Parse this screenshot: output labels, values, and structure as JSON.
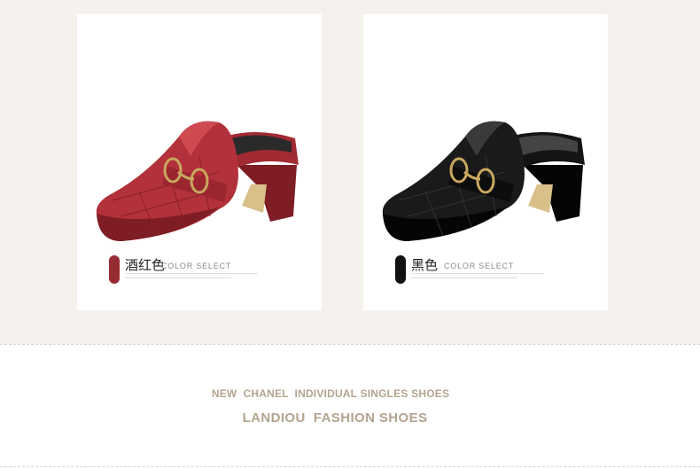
{
  "products": [
    {
      "color_name": "酒红色",
      "color_select": "COLOR SELECT",
      "swatch_color": "#962b32",
      "shoe_main": "#b2313a",
      "shoe_dark": "#7e1d24",
      "shoe_light": "#cf4a50",
      "shoe_icon": "red-mule-shoe"
    },
    {
      "color_name": "黑色",
      "color_select": "COLOR SELECT",
      "swatch_color": "#111111",
      "shoe_main": "#1a1a1a",
      "shoe_dark": "#050505",
      "shoe_light": "#3a3a3a",
      "shoe_icon": "black-mule-shoe"
    }
  ],
  "tagline": {
    "line1": "NEW  CHANEL  INDIVIDUAL SINGLES SHOES",
    "line2": "LANDIOU  FASHION SHOES"
  },
  "colors": {
    "background": "#f5f2ed",
    "tagline": "#b3a48f",
    "hardware_gold": "#c9a860"
  }
}
